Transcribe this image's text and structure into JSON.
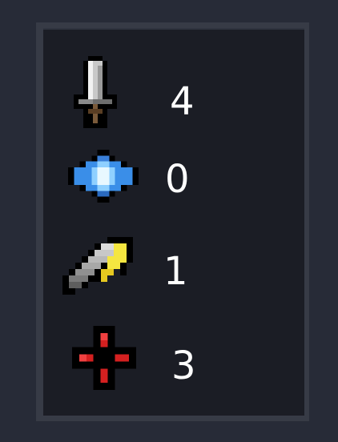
{
  "stats": [
    {
      "name": "attack",
      "icon": "sword-icon",
      "value": "4"
    },
    {
      "name": "shield",
      "icon": "crystal-icon",
      "value": "0"
    },
    {
      "name": "critical",
      "icon": "lightning-blade-icon",
      "value": "1"
    },
    {
      "name": "accuracy",
      "icon": "red-cross-icon",
      "value": "3"
    }
  ],
  "colors": {
    "background": "#272b37",
    "frame": "#373b46",
    "panel": "#1b1d25",
    "text": "#ffffff"
  }
}
